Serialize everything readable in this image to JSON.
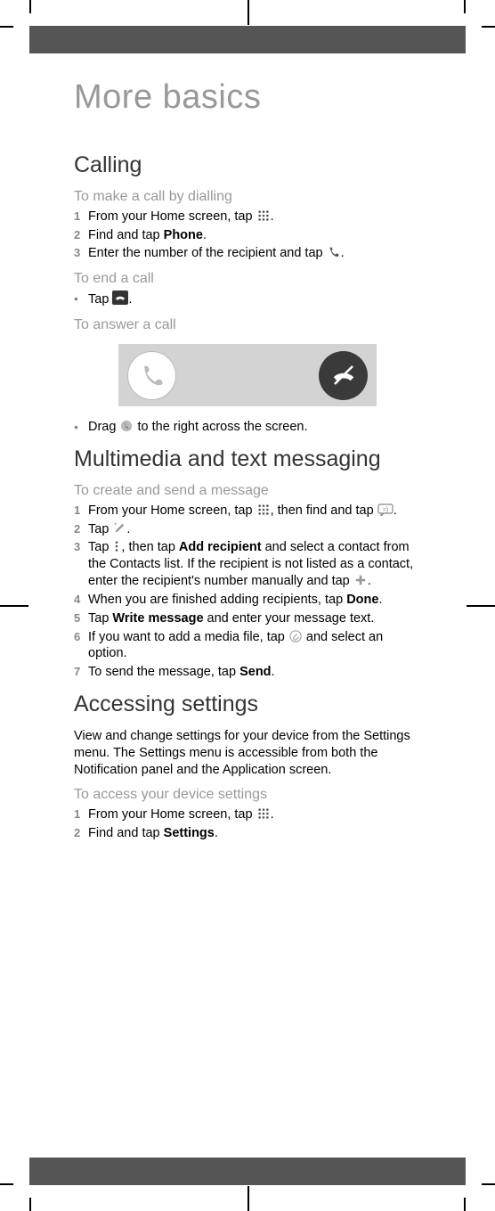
{
  "title": "More basics",
  "calling": {
    "heading": "Calling",
    "dial": {
      "sub": "To make a call by dialling",
      "s1a": "From your Home screen, tap ",
      "s1b": ".",
      "s2a": "Find and tap ",
      "s2b": "Phone",
      "s2c": ".",
      "s3a": "Enter the number of the recipient and tap ",
      "s3b": "."
    },
    "end": {
      "sub": "To end a call",
      "b1a": "Tap ",
      "b1b": "."
    },
    "answer": {
      "sub": "To answer a call",
      "b1a": "Drag ",
      "b1b": " to the right across the screen."
    }
  },
  "msg": {
    "heading": "Multimedia and text messaging",
    "create": {
      "sub": "To create and send a message",
      "s1a": "From your Home screen, tap ",
      "s1b": ", then find and tap ",
      "s1c": ".",
      "s2a": "Tap ",
      "s2b": ".",
      "s3a": "Tap ",
      "s3b": ", then tap ",
      "s3c": "Add recipient",
      "s3d": " and select a contact from the Contacts list. If the recipient is not listed as a contact, enter the recipient's number manually and tap ",
      "s3e": ".",
      "s4a": "When you are finished adding recipients, tap ",
      "s4b": "Done",
      "s4c": ".",
      "s5a": "Tap ",
      "s5b": "Write message",
      "s5c": " and enter your message text.",
      "s6a": "If you want to add a media file, tap ",
      "s6b": " and select an option.",
      "s7a": "To send the message, tap ",
      "s7b": "Send",
      "s7c": "."
    }
  },
  "settings": {
    "heading": "Accessing settings",
    "para": "View and change settings for your device from the Settings menu. The Settings menu is accessible from both the Notification panel and the Application screen.",
    "access": {
      "sub": "To access your device settings",
      "s1a": "From your Home screen, tap ",
      "s1b": ".",
      "s2a": "Find and tap ",
      "s2b": "Settings",
      "s2c": "."
    }
  },
  "nums": {
    "n1": "1",
    "n2": "2",
    "n3": "3",
    "n4": "4",
    "n5": "5",
    "n6": "6",
    "n7": "7"
  }
}
